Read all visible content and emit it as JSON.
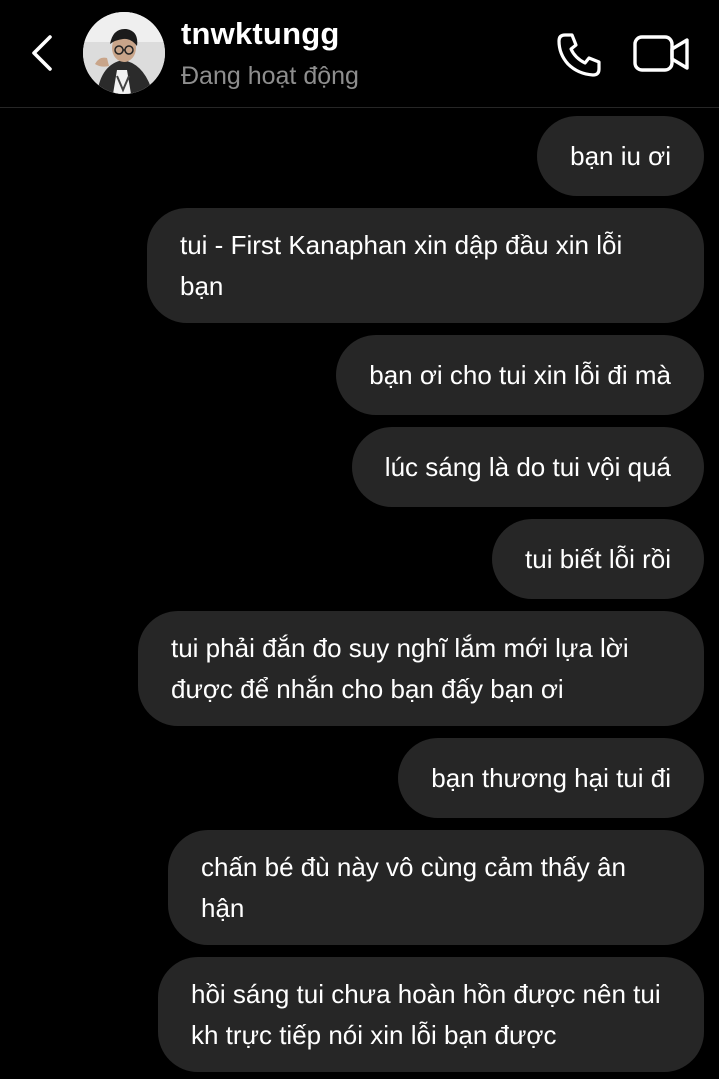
{
  "header": {
    "back_icon": "chevron-left-icon",
    "contact_name": "tnwktungg",
    "status": "Đang hoạt động",
    "call_icon": "phone-icon",
    "video_icon": "video-camera-icon"
  },
  "messages": [
    "bạn iu ơi",
    "tui - First Kanaphan xin dập đầu xin lỗi bạn",
    "bạn ơi cho tui xin lỗi đi mà",
    "lúc sáng là do tui vội quá",
    "tui biết lỗi rồi",
    "tui phải đắn đo suy nghĩ lắm mới lựa lời được để nhắn cho bạn đấy bạn ơi",
    "bạn thương hại tui đi",
    "chấn bé đù này vô cùng cảm thấy ân hận",
    "hồi sáng tui chưa hoàn hồn được nên tui kh trực tiếp nói xin lỗi bạn được"
  ]
}
